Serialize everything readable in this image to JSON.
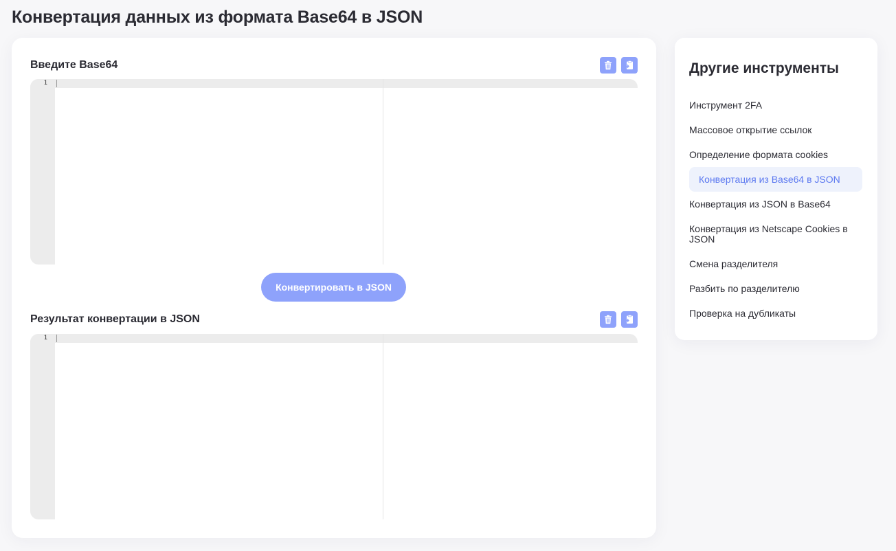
{
  "page": {
    "title": "Конвертация данных из формата Base64 в JSON"
  },
  "input_section": {
    "label": "Введите Base64",
    "line_number": "1"
  },
  "convert_button": {
    "label": "Конвертировать в JSON"
  },
  "output_section": {
    "label": "Результат конвертации в JSON",
    "line_number": "1"
  },
  "icons": {
    "clear": "trash-icon",
    "paste": "clipboard-paste-icon"
  },
  "sidebar": {
    "title": "Другие инструменты",
    "items": [
      {
        "label": "Инструмент 2FA",
        "active": false
      },
      {
        "label": "Массовое открытие ссылок",
        "active": false
      },
      {
        "label": "Определение формата cookies",
        "active": false
      },
      {
        "label": "Конвертация из Base64 в JSON",
        "active": true
      },
      {
        "label": "Конвертация из JSON в Base64",
        "active": false
      },
      {
        "label": "Конвертация из Netscape Cookies в JSON",
        "active": false
      },
      {
        "label": "Смена разделителя",
        "active": false
      },
      {
        "label": "Разбить по разделителю",
        "active": false
      },
      {
        "label": "Проверка на дубликаты",
        "active": false
      }
    ]
  },
  "colors": {
    "accent": "#8ea2fb",
    "active_text": "#5b78f0",
    "active_bg": "#eef2fc",
    "text": "#2b2b33",
    "page_bg": "#f7f7f9"
  }
}
